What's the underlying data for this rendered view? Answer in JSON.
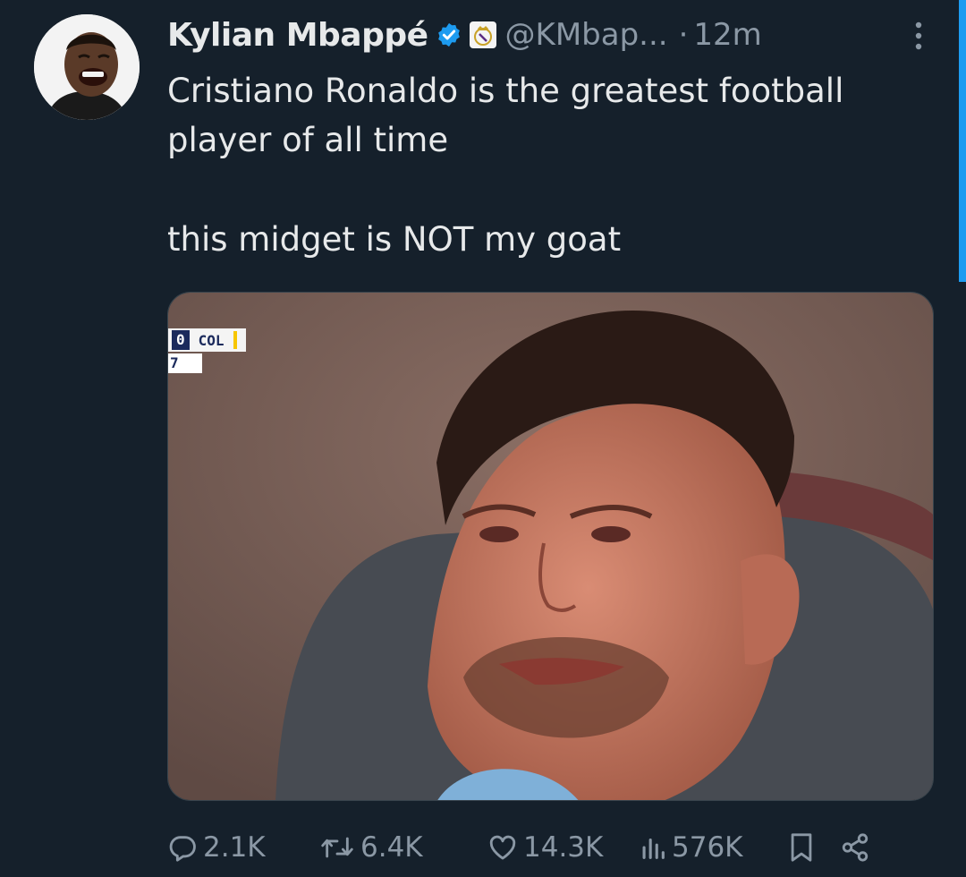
{
  "author": {
    "name": "Kylian Mbappé",
    "handle": "@KMbap...",
    "separator": "·",
    "time": "12m"
  },
  "icons": {
    "verified": "verified-badge-icon",
    "club": "real-madrid-crest-icon",
    "more": "more-options-icon",
    "reply": "reply-icon",
    "repost": "repost-icon",
    "like": "like-icon",
    "views": "views-icon",
    "bookmark": "bookmark-icon",
    "share": "share-icon"
  },
  "tweet": {
    "line1": "Cristiano Ronaldo is the greatest football player of all time",
    "line2": "this midget is NOT my goat"
  },
  "media": {
    "scorebug": {
      "score": "0",
      "team": "COL",
      "clock": "7"
    }
  },
  "actions": {
    "replies": "2.1K",
    "reposts": "6.4K",
    "likes": "14.3K",
    "views": "576K"
  },
  "colors": {
    "background": "#15202b",
    "text": "#e7e9ea",
    "secondary": "#8b98a5",
    "accent": "#1d9bf0"
  }
}
